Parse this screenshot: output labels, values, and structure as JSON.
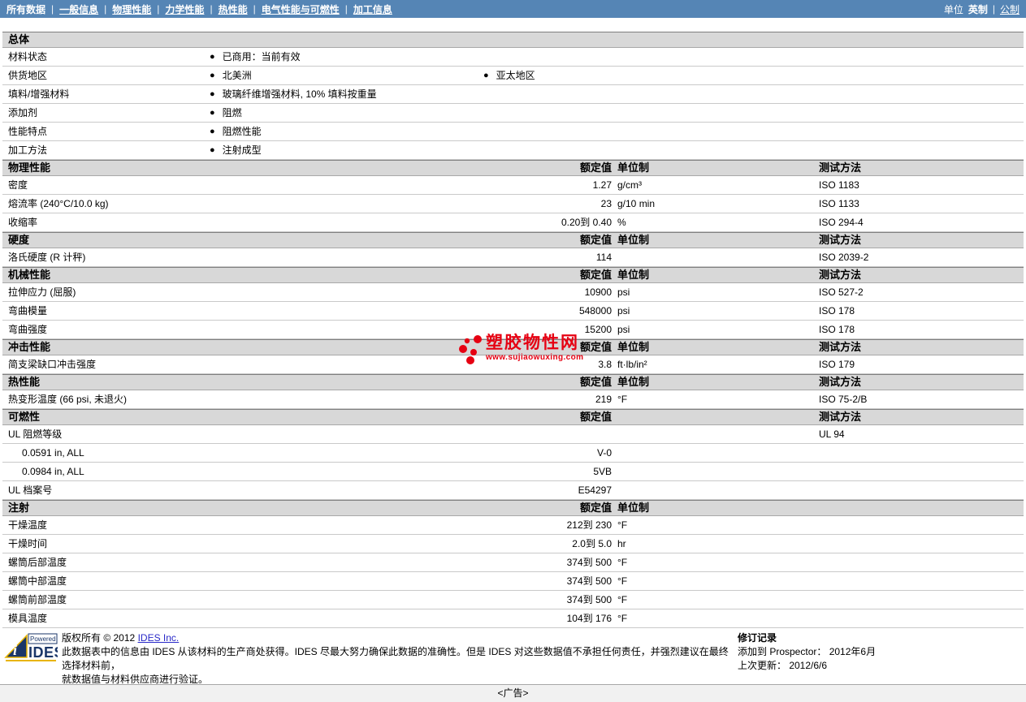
{
  "nav": {
    "items": [
      {
        "label": "所有数据",
        "current": true
      },
      {
        "label": "一般信息",
        "current": false
      },
      {
        "label": "物理性能",
        "current": false
      },
      {
        "label": "力学性能",
        "current": false
      },
      {
        "label": "热性能",
        "current": false
      },
      {
        "label": "电气性能与可燃性",
        "current": false
      },
      {
        "label": "加工信息",
        "current": false
      }
    ],
    "units_label": "单位",
    "units": [
      {
        "label": "英制",
        "current": true
      },
      {
        "label": "公制",
        "current": false
      }
    ]
  },
  "general": {
    "title": "总体",
    "rows": [
      {
        "label": "材料状态",
        "items": [
          "已商用：当前有效"
        ]
      },
      {
        "label": "供货地区",
        "items": [
          "北美洲",
          "亚太地区"
        ]
      },
      {
        "label": "填料/增强材料",
        "items": [
          "玻璃纤维增强材料, 10% 填料按重量"
        ]
      },
      {
        "label": "添加剂",
        "items": [
          "阻燃"
        ]
      },
      {
        "label": "性能特点",
        "items": [
          "阻燃性能"
        ]
      },
      {
        "label": "加工方法",
        "items": [
          "注射成型"
        ]
      }
    ]
  },
  "sections": [
    {
      "title": "物理性能",
      "value_header": "额定值",
      "unit_header": "单位制",
      "method_header": "测试方法",
      "rows": [
        {
          "label": "密度",
          "value": "1.27",
          "unit": "g/cm³",
          "method": "ISO 1183"
        },
        {
          "label": "熔流率  (240°C/10.0 kg)",
          "value": "23",
          "unit": "g/10 min",
          "method": "ISO 1133"
        },
        {
          "label": "收缩率",
          "value": "0.20到 0.40",
          "unit": "%",
          "method": "ISO 294-4"
        }
      ]
    },
    {
      "title": "硬度",
      "value_header": "额定值",
      "unit_header": "单位制",
      "method_header": "测试方法",
      "rows": [
        {
          "label": "洛氏硬度  (R 计秤)",
          "value": "114",
          "unit": "",
          "method": "ISO 2039-2"
        }
      ]
    },
    {
      "title": "机械性能",
      "value_header": "额定值",
      "unit_header": "单位制",
      "method_header": "测试方法",
      "rows": [
        {
          "label": "拉伸应力  (屈服)",
          "value": "10900",
          "unit": "psi",
          "method": "ISO 527-2"
        },
        {
          "label": "弯曲模量",
          "value": "548000",
          "unit": "psi",
          "method": "ISO 178"
        },
        {
          "label": "弯曲强度",
          "value": "15200",
          "unit": "psi",
          "method": "ISO 178"
        }
      ]
    },
    {
      "title": "冲击性能",
      "value_header": "额定值",
      "unit_header": "单位制",
      "method_header": "测试方法",
      "rows": [
        {
          "label": "简支梁缺口冲击强度",
          "value": "3.8",
          "unit": "ft·lb/in²",
          "method": "ISO 179"
        }
      ]
    },
    {
      "title": "热性能",
      "value_header": "额定值",
      "unit_header": "单位制",
      "method_header": "测试方法",
      "rows": [
        {
          "label": "热变形温度  (66 psi, 未退火)",
          "value": "219",
          "unit": "°F",
          "method": "ISO 75-2/B"
        }
      ]
    },
    {
      "title": "可燃性",
      "value_header": "额定值",
      "unit_header": "",
      "method_header": "测试方法",
      "rows": [
        {
          "label": "UL 阻燃等级",
          "value": "",
          "unit": "",
          "method": "UL 94"
        },
        {
          "label": "0.0591 in, ALL",
          "value": "V-0",
          "unit": "",
          "method": "",
          "indent": true
        },
        {
          "label": "0.0984 in, ALL",
          "value": "5VB",
          "unit": "",
          "method": "",
          "indent": true
        },
        {
          "label": "UL 档案号",
          "value": "E54297",
          "unit": "",
          "method": ""
        }
      ]
    },
    {
      "title": "注射",
      "value_header": "额定值",
      "unit_header": "单位制",
      "method_header": "",
      "rows": [
        {
          "label": "干燥温度",
          "value": "212到 230",
          "unit": "°F",
          "method": ""
        },
        {
          "label": "干燥时间",
          "value": "2.0到 5.0",
          "unit": "hr",
          "method": ""
        },
        {
          "label": "螺筒后部温度",
          "value": "374到 500",
          "unit": "°F",
          "method": ""
        },
        {
          "label": "螺筒中部温度",
          "value": "374到 500",
          "unit": "°F",
          "method": ""
        },
        {
          "label": "螺筒前部温度",
          "value": "374到 500",
          "unit": "°F",
          "method": ""
        },
        {
          "label": "模具温度",
          "value": "104到 176",
          "unit": "°F",
          "method": ""
        }
      ]
    }
  ],
  "watermark": {
    "site_name": "塑胶物性网",
    "site_url": "www.sujiaowuxing.com",
    "color": "#e60012"
  },
  "footer": {
    "logo_powered_by": "Powered by",
    "logo_text": "IDES",
    "copyright_prefix": "版权所有  © 2012",
    "copyright_link": "IDES Inc.",
    "disclaimer_line1": "此数据表中的信息由 IDES 从该材料的生产商处获得。IDES 尽最大努力确保此数据的准确性。但是 IDES 对这些数据值不承担任何责任，并强烈建议在最终选择材料前，",
    "disclaimer_line2": "就数据值与材料供应商进行验证。",
    "revision_title": "修订记录",
    "revision_rows": [
      "添加到 Prospector：  2012年6月",
      "上次更新：  2012/6/6"
    ]
  },
  "ad_label": "<广告>",
  "colors": {
    "nav_bg": "#5585b5",
    "section_header_bg": "#d8d8d8",
    "watermark_red": "#e60012",
    "link_blue": "#2929c8",
    "logo_navy": "#1a3668",
    "logo_gold": "#e8b400"
  }
}
